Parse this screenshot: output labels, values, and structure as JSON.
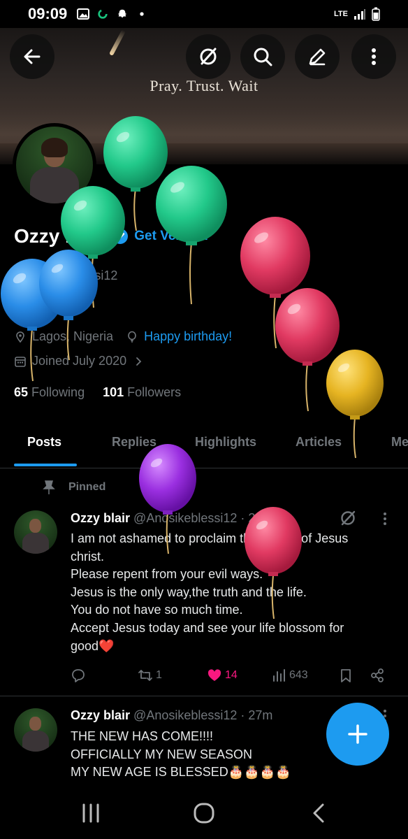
{
  "status_bar": {
    "time": "09:09",
    "network": "LTE"
  },
  "header": {
    "banner_text": "Pray. Trust. Wait",
    "back_icon": "back-arrow-icon",
    "grok_icon": "grok-icon",
    "search_icon": "search-icon",
    "edit_icon": "edit-icon",
    "more_icon": "more-vertical-icon"
  },
  "profile": {
    "name": "Ozzy blair",
    "get_verified": "Get Verified",
    "handle": "@Anosikeblessi12",
    "bio": "Simplicity",
    "location": "Lagos, Nigeria",
    "birthday": "Happy birthday!",
    "joined": "Joined July 2020",
    "following_count": "65",
    "following_label": "Following",
    "followers_count": "101",
    "followers_label": "Followers"
  },
  "tabs": [
    {
      "label": "Posts"
    },
    {
      "label": "Replies"
    },
    {
      "label": "Highlights"
    },
    {
      "label": "Articles"
    },
    {
      "label": "Me"
    }
  ],
  "posts": [
    {
      "pinned_label": "Pinned",
      "author": "Ozzy blair",
      "meta": "@Anosikeblessi12 · 20 Mar",
      "lines": [
        "I am not ashamed to proclaim the gospel of Jesus",
        "christ.",
        "Please repent from your evil ways.",
        "Jesus is the only way,the truth and the life.",
        "You do not have so much time.",
        "Accept Jesus today and see your life blossom for",
        "good❤️"
      ],
      "reposts": "1",
      "likes": "14",
      "views": "643"
    },
    {
      "author": "Ozzy blair",
      "meta": "@Anosikeblessi12 · 27m",
      "lines": [
        "THE NEW HAS COME!!!!",
        "OFFICIALLY MY NEW SEASON",
        "MY NEW AGE IS BLESSED🎂🎂🎂🎂"
      ]
    }
  ],
  "colors": {
    "accent": "#1d9bf0",
    "like": "#f91880",
    "muted": "#71767b"
  }
}
